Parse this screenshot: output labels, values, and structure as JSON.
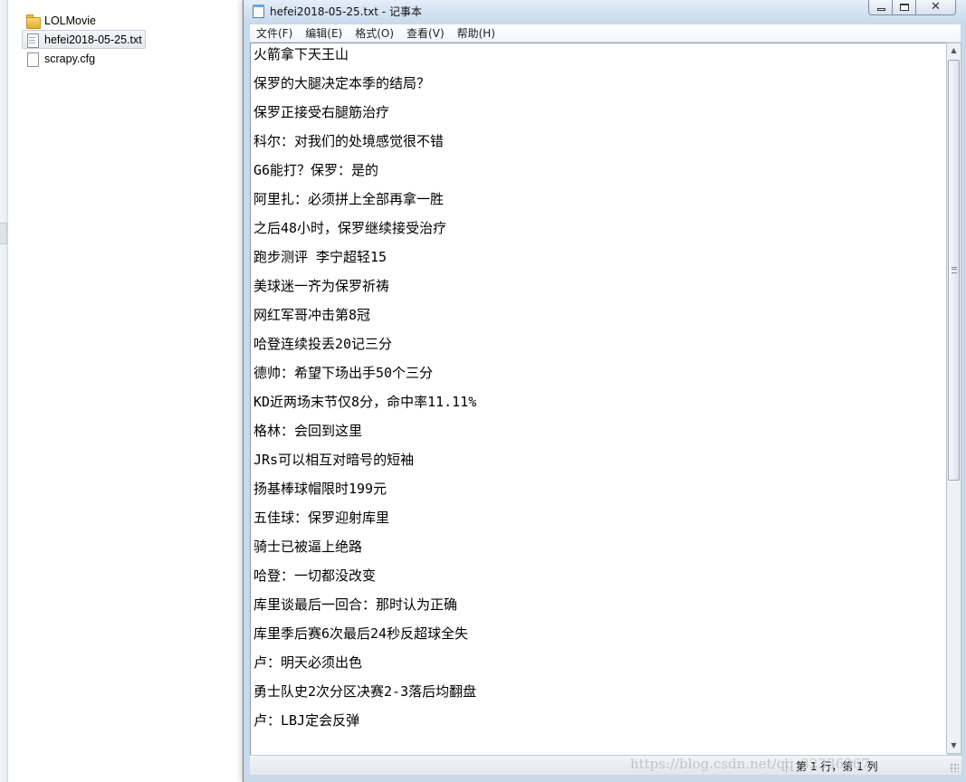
{
  "explorer": {
    "files": [
      {
        "name": "LOLMovie",
        "icon": "folder-icon"
      },
      {
        "name": "hefei2018-05-25.txt",
        "icon": "text-file-icon"
      },
      {
        "name": "scrapy.cfg",
        "icon": "file-icon"
      }
    ]
  },
  "notepad": {
    "title": "hefei2018-05-25.txt - 记事本",
    "window_buttons": {
      "minimize": "minimize",
      "maximize": "maximize",
      "close": "✕"
    },
    "menu": [
      "文件(F)",
      "编辑(E)",
      "格式(O)",
      "查看(V)",
      "帮助(H)"
    ],
    "lines": [
      "火箭拿下天王山",
      "保罗的大腿决定本季的结局？",
      "保罗正接受右腿筋治疗",
      "科尔：对我们的处境感觉很不错",
      "G6能打？保罗：是的",
      "阿里扎：必须拼上全部再拿一胜",
      "之后48小时，保罗继续接受治疗",
      "跑步测评 李宁超轻15",
      "美球迷一齐为保罗祈祷",
      "网红军哥冲击第8冠",
      "哈登连续投丢20记三分",
      "德帅：希望下场出手50个三分",
      "KD近两场末节仅8分，命中率11.11%",
      "格林：会回到这里",
      "JRs可以相互对暗号的短袖",
      "扬基棒球帽限时199元",
      "五佳球：保罗迎射库里",
      "骑士已被逼上绝路",
      "哈登：一切都没改变",
      "库里谈最后一回合：那时认为正确",
      "库里季后赛6次最后24秒反超球全失",
      "卢：明天必须出色",
      "勇士队史2次分区决赛2-3落后均翻盘",
      "卢：LBJ定会反弹"
    ],
    "status": "第 1 行，第 1 列"
  },
  "watermark": "https://blog.csdn.net/qq_32336967"
}
